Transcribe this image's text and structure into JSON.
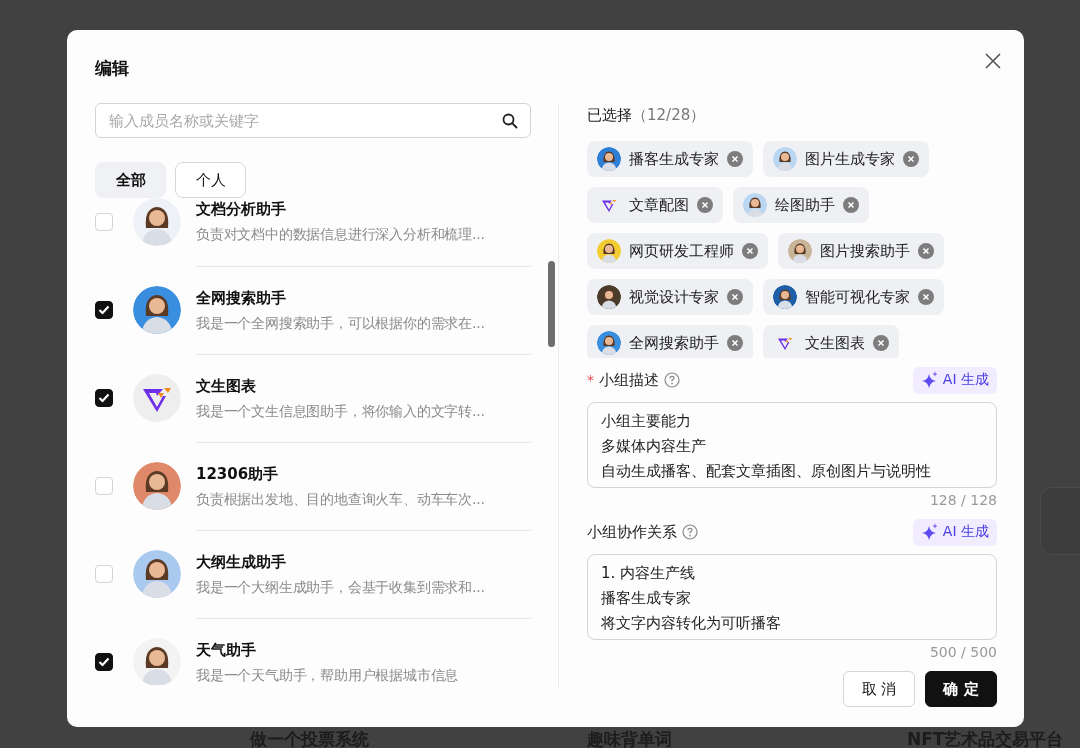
{
  "dialog": {
    "title": "编辑",
    "search": {
      "placeholder": "输入成员名称或关键字"
    },
    "filters": [
      {
        "label": "全部",
        "selected": true
      },
      {
        "label": "个人",
        "selected": false
      }
    ],
    "members": [
      {
        "name": "文档分析助手",
        "description": "负责对文档中的数据信息进行深入分析和梳理...",
        "checked": false,
        "avatar": {
          "kind": "person",
          "color": "#eef1f5"
        }
      },
      {
        "name": "全网搜索助手",
        "description": "我是一个全网搜索助手，可以根据你的需求在...",
        "checked": true,
        "avatar": {
          "kind": "person",
          "color": "#3a8ee0"
        }
      },
      {
        "name": "文生图表",
        "description": "我是一个文生信息图助手，将你输入的文字转...",
        "checked": true,
        "avatar": {
          "kind": "logo",
          "color": "#eeeeef"
        }
      },
      {
        "name": "12306助手",
        "description": "负责根据出发地、目的地查询火车、动车车次...",
        "checked": false,
        "avatar": {
          "kind": "person",
          "color": "#e0896a"
        }
      },
      {
        "name": "大纲生成助手",
        "description": "我是一个大纲生成助手，会基于收集到需求和...",
        "checked": false,
        "avatar": {
          "kind": "person",
          "color": "#a9c9ef"
        }
      },
      {
        "name": "天气助手",
        "description": "我是一个天气助手，帮助用户根据城市信息",
        "checked": true,
        "avatar": {
          "kind": "person",
          "color": "#f3f3f3"
        }
      }
    ],
    "selected_header": {
      "label": "已选择",
      "count": "（12/28）"
    },
    "selected_tags": [
      {
        "name": "播客生成专家",
        "avatar": {
          "kind": "person",
          "color": "#2f7fd6"
        }
      },
      {
        "name": "图片生成专家",
        "avatar": {
          "kind": "person",
          "color": "#b9d6f2"
        }
      },
      {
        "name": "文章配图",
        "avatar": {
          "kind": "logo"
        }
      },
      {
        "name": "绘图助手",
        "avatar": {
          "kind": "person",
          "color": "#b9d6f2"
        }
      },
      {
        "name": "网页研发工程师",
        "avatar": {
          "kind": "person",
          "color": "#f2cc30"
        }
      },
      {
        "name": "图片搜索助手",
        "avatar": {
          "kind": "person",
          "color": "#c9b59a"
        }
      },
      {
        "name": "视觉设计专家",
        "avatar": {
          "kind": "person",
          "color": "#4a3b2a"
        }
      },
      {
        "name": "智能可视化专家",
        "avatar": {
          "kind": "person",
          "color": "#1f5fa8"
        }
      },
      {
        "name": "全网搜索助手",
        "avatar": {
          "kind": "person",
          "color": "#3a8ee0"
        }
      },
      {
        "name": "文生图表",
        "avatar": {
          "kind": "logo"
        }
      }
    ],
    "fields": [
      {
        "required_mark": "*",
        "label": "小组描述",
        "ai_button": "AI 生成",
        "lines": [
          "小组主要能力",
          "多媒体内容生产",
          "自动生成播客、配套文章插图、原创图片与说明性"
        ],
        "counter": "128 / 128"
      },
      {
        "label": "小组协作关系",
        "ai_button": "AI 生成",
        "lines": [
          "1. 内容生产线",
          "播客生成专家",
          "将文字内容转化为可听播客"
        ],
        "counter": "500 / 500"
      }
    ],
    "buttons": [
      {
        "label": "取 消",
        "kind": "secondary"
      },
      {
        "label": "确 定",
        "kind": "primary"
      }
    ]
  },
  "background": {
    "cards": [
      "做一个投票系统",
      "趣味背单词",
      "NFT艺术品交易平台"
    ]
  }
}
